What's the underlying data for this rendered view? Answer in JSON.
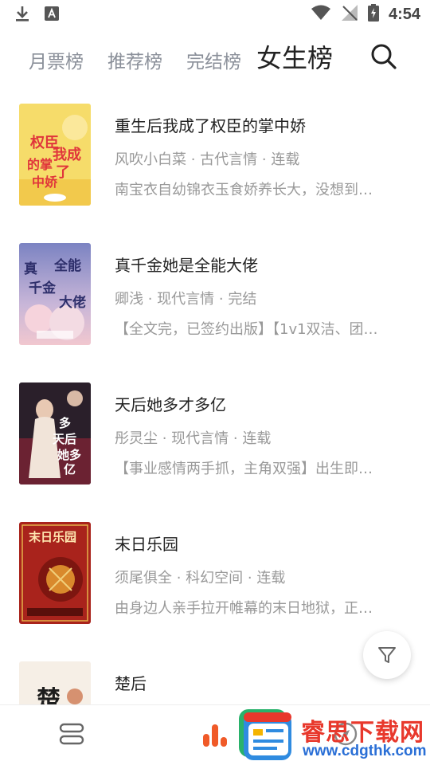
{
  "status_bar": {
    "time": "4:54"
  },
  "tabs": [
    {
      "label": "月票榜",
      "active": false
    },
    {
      "label": "推荐榜",
      "active": false
    },
    {
      "label": "完结榜",
      "active": false
    },
    {
      "label": "女生榜",
      "active": true
    }
  ],
  "books": [
    {
      "title": "重生后我成了权臣的掌中娇",
      "meta": "风吹小白菜 · 古代言情 · 连载",
      "desc": "南宝衣自幼锦衣玉食娇养长大，没想到…",
      "cover_text": "权臣的掌中娇我成了"
    },
    {
      "title": "真千金她是全能大佬",
      "meta": "卿浅 · 现代言情 · 完结",
      "desc": "【全文完，已签约出版】【1v1双洁、团…",
      "cover_text": "真千金全能大佬"
    },
    {
      "title": "天后她多才多亿",
      "meta": "彤灵尘 · 现代言情 · 连载",
      "desc": "【事业感情两手抓，主角双强】出生即…",
      "cover_text": "天后她多才多亿"
    },
    {
      "title": "末日乐园",
      "meta": "须尾俱全 · 科幻空间 · 连载",
      "desc": "由身边人亲手拉开帷幕的末日地狱，正…",
      "cover_text": "末日乐园"
    },
    {
      "title": "楚后",
      "meta": "",
      "desc": "",
      "cover_text": "楚"
    }
  ],
  "watermark": {
    "name": "睿思下载网",
    "url": "www.cdgthk.com"
  },
  "colors": {
    "accent": "#f05a28",
    "muted": "#999999",
    "title": "#222222"
  }
}
